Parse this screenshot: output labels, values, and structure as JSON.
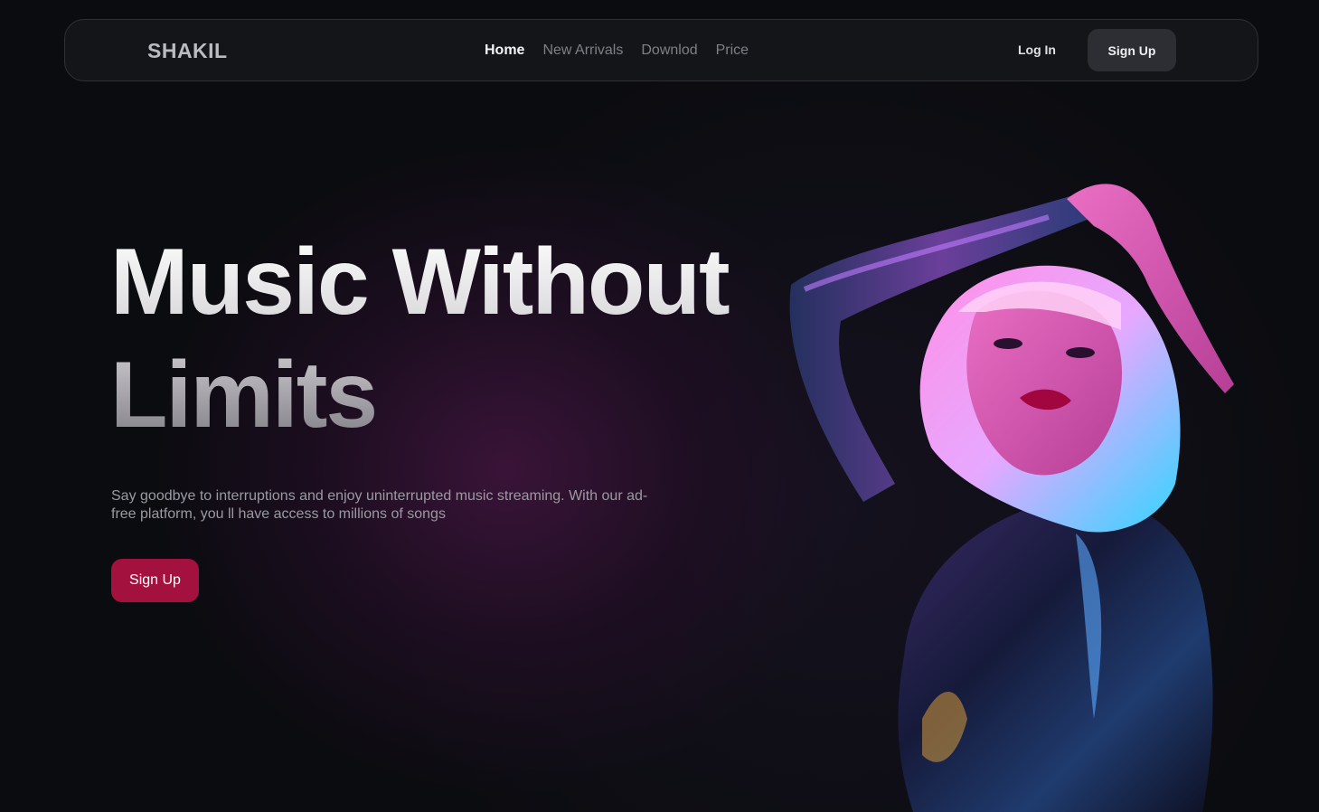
{
  "nav": {
    "brand": "SHAKIL",
    "links": [
      {
        "label": "Home",
        "active": true
      },
      {
        "label": "New Arrivals",
        "active": false
      },
      {
        "label": "Downlod",
        "active": false
      },
      {
        "label": "Price",
        "active": false
      }
    ],
    "login_label": "Log In",
    "signup_label": "Sign Up"
  },
  "hero": {
    "title_line1": "Music Without",
    "title_line2": "Limits",
    "description": "Say goodbye to interruptions and enjoy uninterrupted music streaming. With our ad-free platform, you ll have access to millions of songs",
    "cta_label": "Sign Up",
    "cta_color": "#a3123f"
  },
  "icons": {
    "hero_image": "woman-portrait-image"
  }
}
